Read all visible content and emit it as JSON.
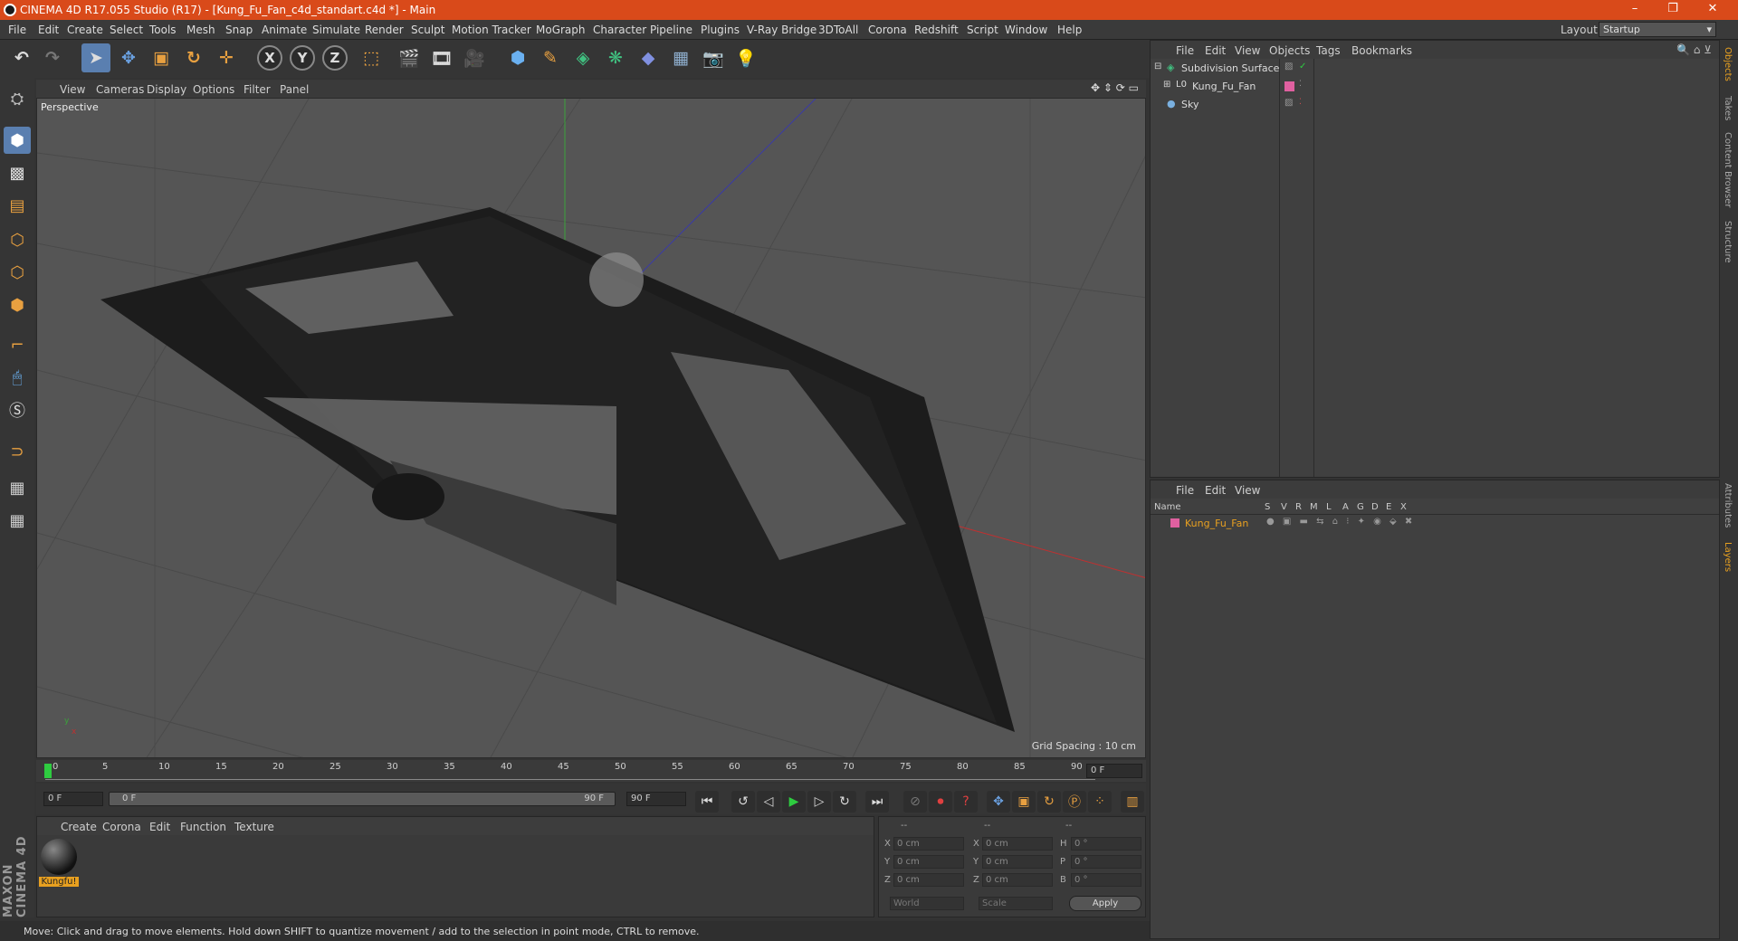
{
  "window": {
    "title": "CINEMA 4D R17.055 Studio (R17) - [Kung_Fu_Fan_c4d_standart.c4d *] - Main",
    "controls": [
      "–",
      "❐",
      "✕"
    ]
  },
  "menu": [
    "File",
    "Edit",
    "Create",
    "Select",
    "Tools",
    "Mesh",
    "Snap",
    "Animate",
    "Simulate",
    "Render",
    "Sculpt",
    "Motion Tracker",
    "MoGraph",
    "Character",
    "Pipeline",
    "Plugins",
    "V-Ray Bridge",
    "3DToAll",
    "Corona",
    "Redshift",
    "Script",
    "Window",
    "Help"
  ],
  "layout": {
    "label": "Layout:",
    "value": "Startup"
  },
  "toolbar": {
    "x": "X",
    "y": "Y",
    "z": "Z"
  },
  "viewport": {
    "menu": [
      "View",
      "Cameras",
      "Display",
      "Options",
      "Filter",
      "Panel"
    ],
    "label": "Perspective",
    "grid_spacing": "Grid Spacing : 10 cm"
  },
  "timeline": {
    "ticks": [
      "0",
      "5",
      "10",
      "15",
      "20",
      "25",
      "30",
      "35",
      "40",
      "45",
      "50",
      "55",
      "60",
      "65",
      "70",
      "75",
      "80",
      "85",
      "90"
    ],
    "current_frame": "0 F",
    "start": "0 F",
    "range_start": "0 F",
    "range_end": "90 F",
    "end": "90 F"
  },
  "material_manager": {
    "menu": [
      "Create",
      "Corona",
      "Edit",
      "Function",
      "Texture"
    ],
    "material_name": "Kungfu!"
  },
  "coordinates": {
    "headers": [
      "--",
      "--",
      "--"
    ],
    "rows": [
      {
        "a": "X",
        "av": "0 cm",
        "b": "X",
        "bv": "0 cm",
        "c": "H",
        "cv": "0 °"
      },
      {
        "a": "Y",
        "av": "0 cm",
        "b": "Y",
        "bv": "0 cm",
        "c": "P",
        "cv": "0 °"
      },
      {
        "a": "Z",
        "av": "0 cm",
        "b": "Z",
        "bv": "0 cm",
        "c": "B",
        "cv": "0 °"
      }
    ],
    "mode1": "World",
    "mode2": "Scale",
    "apply": "Apply"
  },
  "status": "Move: Click and drag to move elements. Hold down SHIFT to quantize movement / add to the selection in point mode, CTRL to remove.",
  "object_manager": {
    "menu": [
      "File",
      "Edit",
      "View",
      "Objects",
      "Tags",
      "Bookmarks"
    ],
    "objects": [
      {
        "name": "Subdivision Surface"
      },
      {
        "name": "Kung_Fu_Fan"
      },
      {
        "name": "Sky"
      }
    ]
  },
  "layer_manager": {
    "menu": [
      "File",
      "Edit",
      "View"
    ],
    "headers": [
      "Name",
      "S",
      "V",
      "R",
      "M",
      "L",
      "A",
      "G",
      "D",
      "E",
      "X"
    ],
    "layers": [
      {
        "name": "Kung_Fu_Fan",
        "color": "#e060a0"
      }
    ]
  },
  "side_tabs": [
    "Objects",
    "Takes",
    "Content Browser",
    "Structure",
    "Attributes",
    "Layers"
  ],
  "brand": "MAXON CINEMA 4D"
}
